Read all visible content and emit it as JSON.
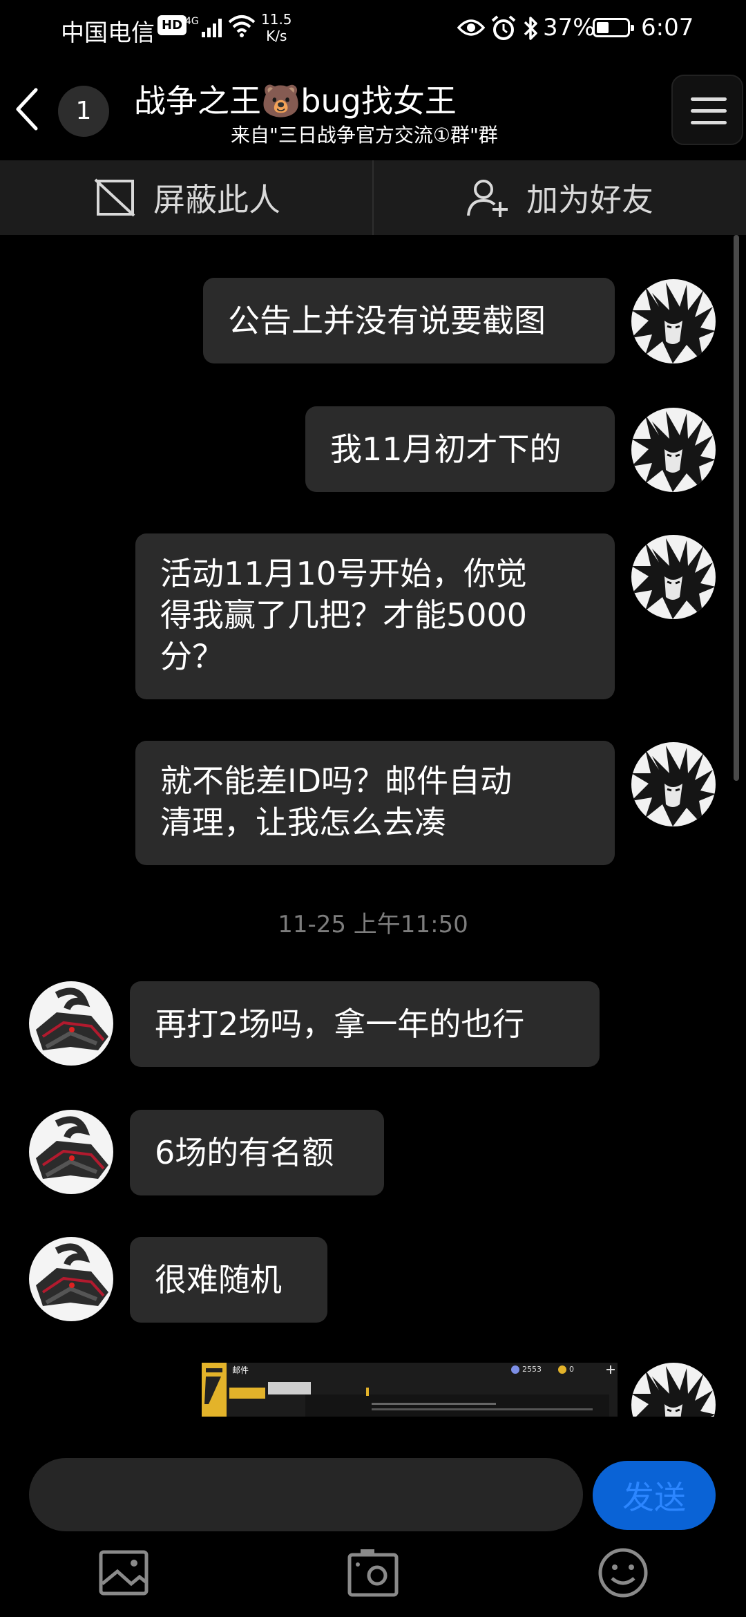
{
  "status_bar": {
    "carrier": "中国电信",
    "hd_badge": "HD",
    "network_type": "4G",
    "speed_value": "11.5",
    "speed_unit": "K/s",
    "battery_percent": "37%",
    "time": "6:07"
  },
  "header": {
    "unread_count": "1",
    "title": "战争之王🐻bug找女王",
    "subtitle": "来自\"三日战争官方交流①群\"群"
  },
  "actions": {
    "block_label": "屏蔽此人",
    "add_friend_label": "加为好友"
  },
  "messages": [
    {
      "side": "right",
      "text": "公告上并没有说要截图"
    },
    {
      "side": "right",
      "text": "我11月初才下的"
    },
    {
      "side": "right",
      "line1": "活动11月10号开始，你觉",
      "line2": "得我赢了几把？才能5000",
      "line3": "分？"
    },
    {
      "side": "right",
      "line1": "就不能差ID吗？邮件自动",
      "line2": "清理，让我怎么去凑"
    },
    {
      "side": "left",
      "text": "再打2场吗，拿一年的也行"
    },
    {
      "side": "left",
      "text": "6场的有名额"
    },
    {
      "side": "left",
      "text": "很难随机"
    }
  ],
  "timestamp": "11-25 上午11:50",
  "image_message": {
    "title": "邮件",
    "currency1": "2553",
    "currency2": "0"
  },
  "input": {
    "placeholder": "",
    "send_label": "发送"
  },
  "colors": {
    "background": "#000000",
    "bubble": "#2b2b2b",
    "send_button": "#0a63d6",
    "send_text": "#2c86ff",
    "timestamp": "#7d7d7d"
  }
}
